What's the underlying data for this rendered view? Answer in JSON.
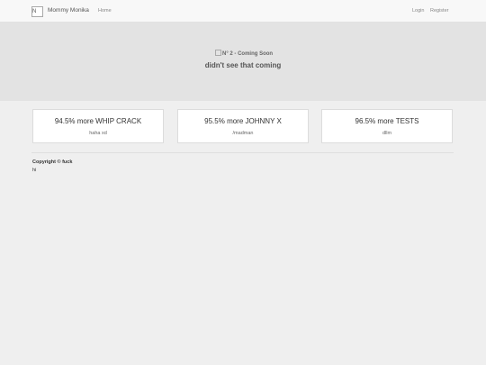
{
  "navbar": {
    "logo_alt": "N",
    "brand": "Mommy Monika",
    "home": "Home",
    "login": "Login",
    "register": "Register"
  },
  "hero": {
    "image_alt": "N° 2 - Coming Soon",
    "subtitle": "didn't see that coming"
  },
  "cards": [
    {
      "title": "94.5% more WHIP CRACK",
      "subtitle": "haha xd"
    },
    {
      "title": "95.5% more JOHNNY X",
      "subtitle": "/madman"
    },
    {
      "title": "96.5% more TESTS",
      "subtitle": "dllm"
    }
  ],
  "footer": {
    "copyright": "Copyright © fuck",
    "note": "hi"
  }
}
